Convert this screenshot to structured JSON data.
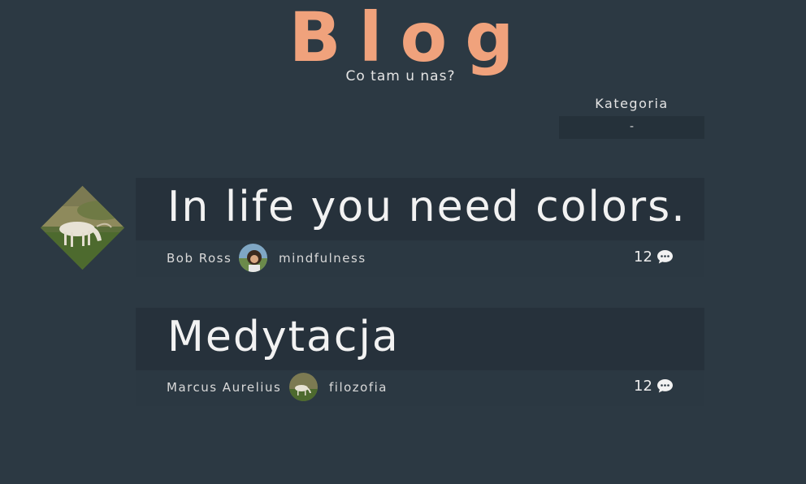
{
  "header": {
    "title": "Blog",
    "subtitle": "Co tam u nas?"
  },
  "category": {
    "label": "Kategoria",
    "selected": "-"
  },
  "posts": [
    {
      "title": "In life you need colors.",
      "author": "Bob Ross",
      "tag": "mindfulness",
      "comments": "12"
    },
    {
      "title": "Medytacja",
      "author": "Marcus Aurelius",
      "tag": "filozofia",
      "comments": "12"
    }
  ],
  "icons": {
    "comment": "speech-bubble-icon"
  },
  "colors": {
    "background": "#2c3943",
    "accent": "#f0a27c",
    "card": "#26313b"
  }
}
